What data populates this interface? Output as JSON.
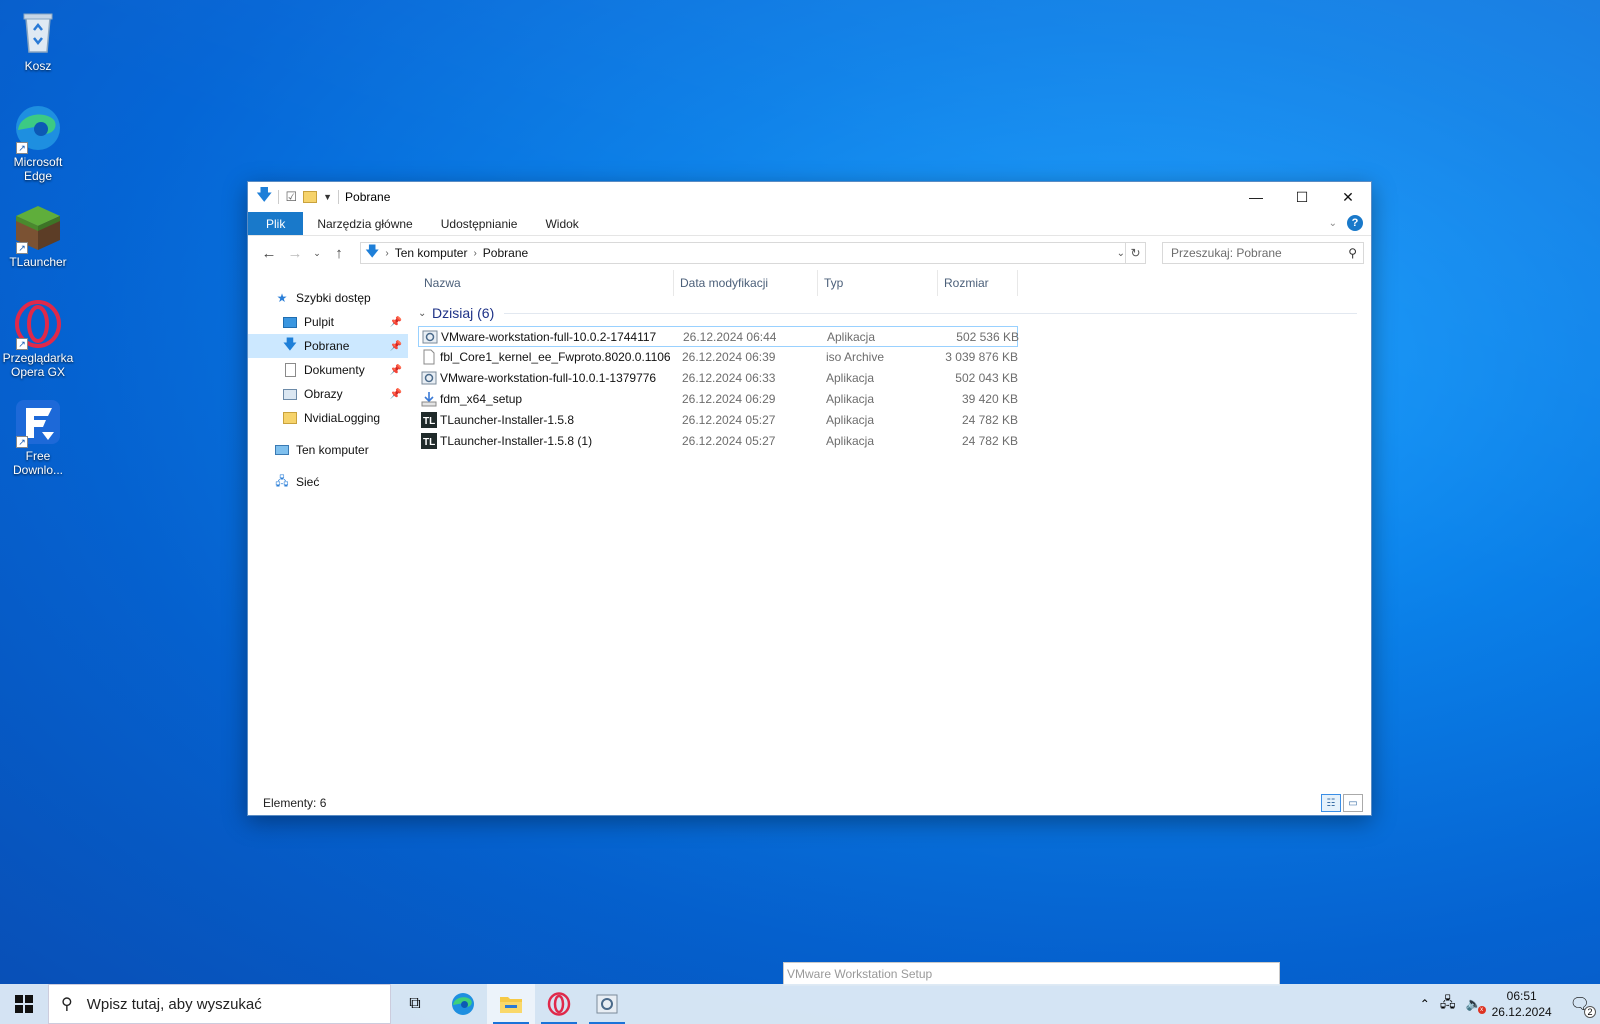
{
  "desktop": {
    "icons": [
      {
        "label": "Kosz"
      },
      {
        "label": "Microsoft Edge"
      },
      {
        "label": "TLauncher"
      },
      {
        "label": "Przeglądarka Opera GX"
      },
      {
        "label": "Free Downlo..."
      }
    ]
  },
  "window": {
    "title": "Pobrane",
    "ribbon_tabs": [
      "Plik",
      "Narzędzia główne",
      "Udostępnianie",
      "Widok"
    ],
    "address": {
      "crumbs": [
        "Ten komputer",
        "Pobrane"
      ]
    },
    "search_placeholder": "Przeszukaj: Pobrane",
    "nav": {
      "quick_access": "Szybki dostęp",
      "items": [
        "Pulpit",
        "Pobrane",
        "Dokumenty",
        "Obrazy",
        "NvidiaLogging"
      ],
      "this_pc": "Ten komputer",
      "network": "Sieć"
    },
    "columns": {
      "name": "Nazwa",
      "date": "Data modyfikacji",
      "type": "Typ",
      "size": "Rozmiar"
    },
    "group_label": "Dzisiaj (6)",
    "files": [
      {
        "name": "VMware-workstation-full-10.0.2-1744117",
        "date": "26.12.2024 06:44",
        "type": "Aplikacja",
        "size": "502 536 KB",
        "icon": "vmware-installer-icon"
      },
      {
        "name": "fbl_Core1_kernel_ee_Fwproto.8020.0.1106...",
        "date": "26.12.2024 06:39",
        "type": "iso Archive",
        "size": "3 039 876 KB",
        "icon": "file-icon"
      },
      {
        "name": "VMware-workstation-full-10.0.1-1379776",
        "date": "26.12.2024 06:33",
        "type": "Aplikacja",
        "size": "502 043 KB",
        "icon": "vmware-installer-icon"
      },
      {
        "name": "fdm_x64_setup",
        "date": "26.12.2024 06:29",
        "type": "Aplikacja",
        "size": "39 420 KB",
        "icon": "installer-icon"
      },
      {
        "name": "TLauncher-Installer-1.5.8",
        "date": "26.12.2024 05:27",
        "type": "Aplikacja",
        "size": "24 782 KB",
        "icon": "tlauncher-icon"
      },
      {
        "name": "TLauncher-Installer-1.5.8 (1)",
        "date": "26.12.2024 05:27",
        "type": "Aplikacja",
        "size": "24 782 KB",
        "icon": "tlauncher-icon"
      }
    ],
    "status": "Elementy: 6"
  },
  "tooltip": "VMware Workstation Setup",
  "taskbar": {
    "search_placeholder": "Wpisz tutaj, aby wyszukać",
    "time": "06:51",
    "date": "26.12.2024",
    "notification_count": "2"
  },
  "colors": {
    "accent": "#1979ca",
    "selection": "#cce8ff",
    "group_text": "#1e3287"
  }
}
